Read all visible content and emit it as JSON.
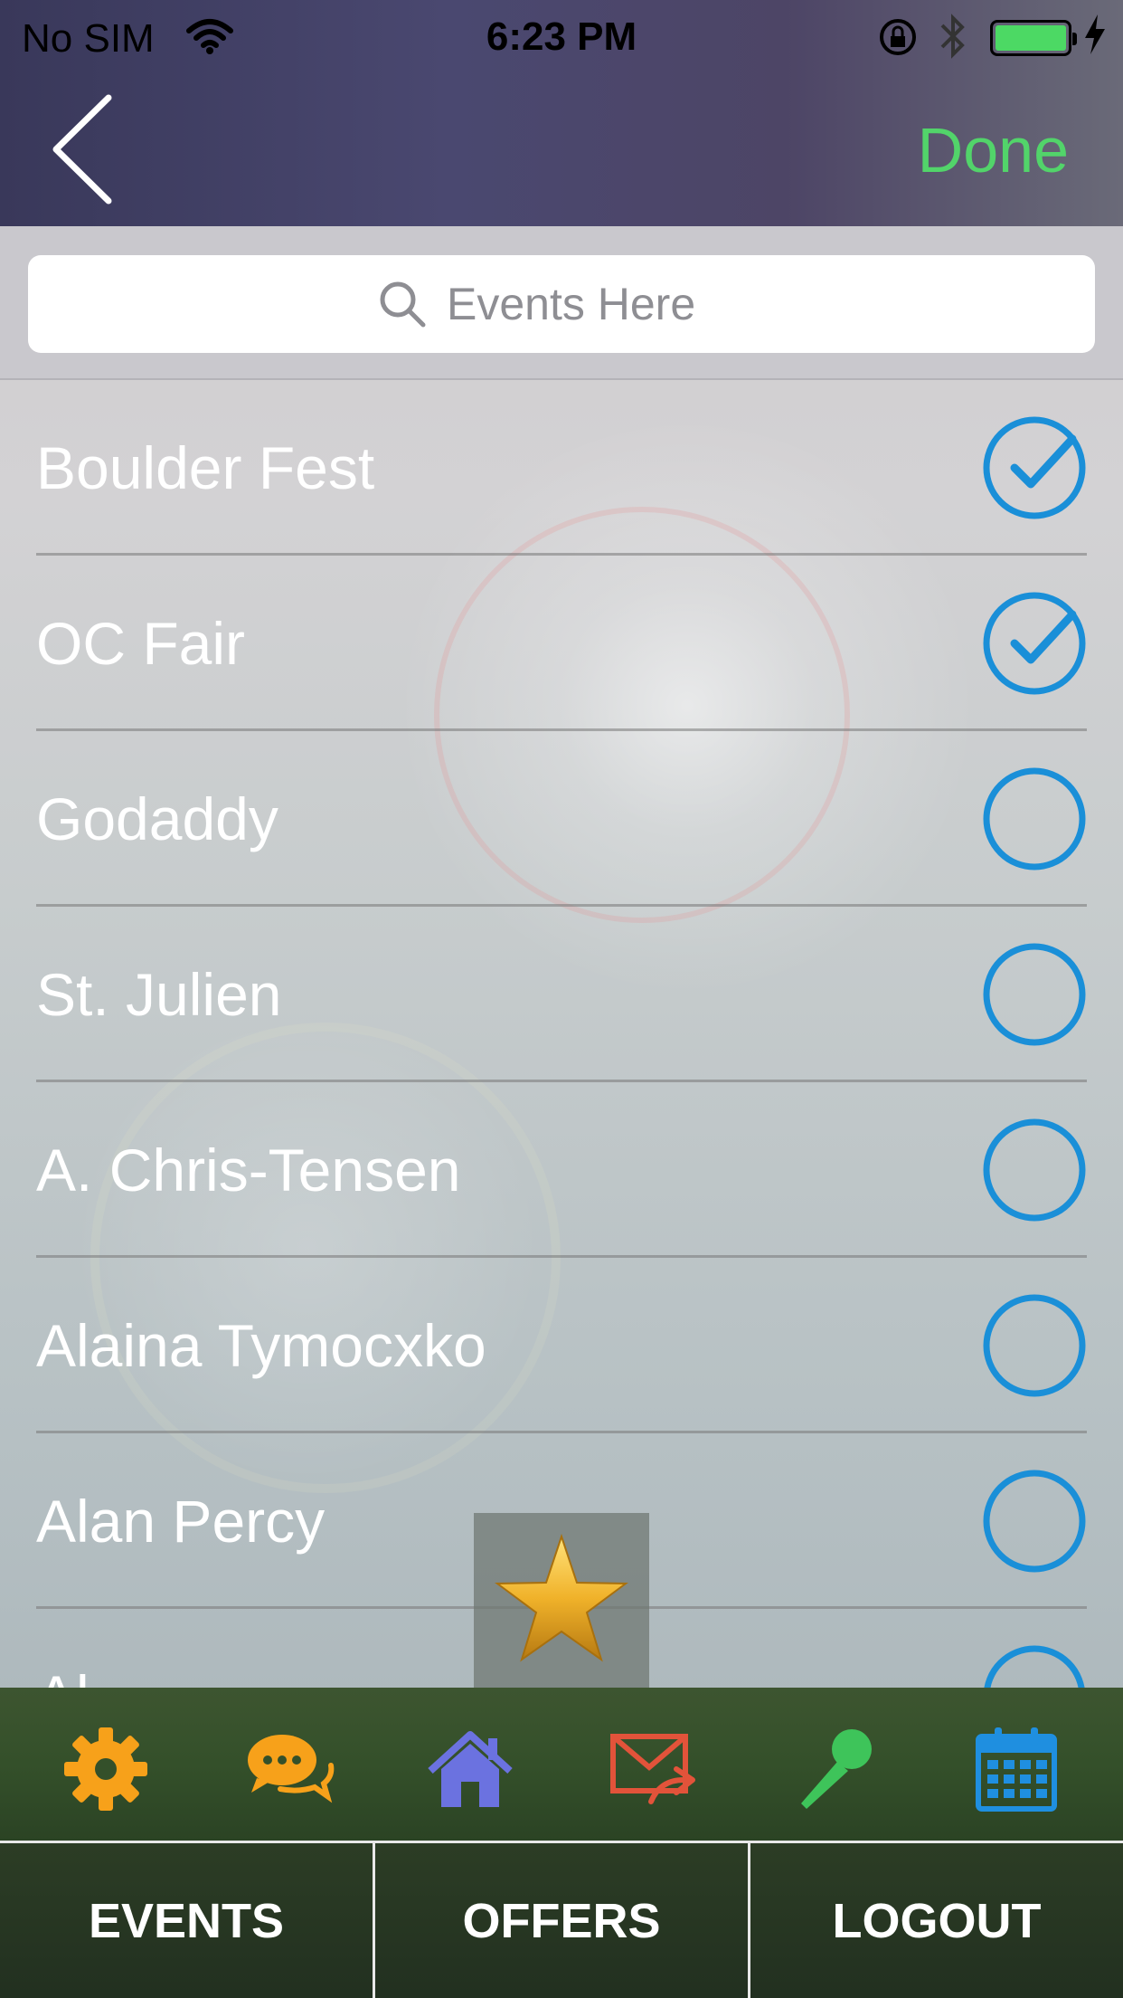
{
  "status_bar": {
    "carrier": "No SIM",
    "time": "6:23 PM"
  },
  "nav": {
    "done_label": "Done"
  },
  "search": {
    "placeholder": "Events Here"
  },
  "events": [
    {
      "name": "Boulder Fest",
      "selected": true
    },
    {
      "name": "OC Fair",
      "selected": true
    },
    {
      "name": "Godaddy",
      "selected": false
    },
    {
      "name": "St. Julien",
      "selected": false
    },
    {
      "name": "A. Chris-Tensen",
      "selected": false
    },
    {
      "name": "Alaina Tymocxko",
      "selected": false
    },
    {
      "name": "Alan Percy",
      "selected": false
    },
    {
      "name": "Al...",
      "selected": false
    }
  ],
  "icon_bar": [
    {
      "icon": "gear-icon",
      "color": "#f7a11a"
    },
    {
      "icon": "chat-icon",
      "color": "#f7a11a"
    },
    {
      "icon": "home-icon",
      "color": "#6b72e0"
    },
    {
      "icon": "mail-forward-icon",
      "color": "#e2533a"
    },
    {
      "icon": "microphone-icon",
      "color": "#3ec45a"
    },
    {
      "icon": "calendar-icon",
      "color": "#1f8fe0"
    }
  ],
  "tabs": [
    {
      "label": "EVENTS"
    },
    {
      "label": "OFFERS"
    },
    {
      "label": "LOGOUT"
    }
  ],
  "colors": {
    "accent_green": "#52d46a",
    "check_blue": "#1a8fd8"
  }
}
